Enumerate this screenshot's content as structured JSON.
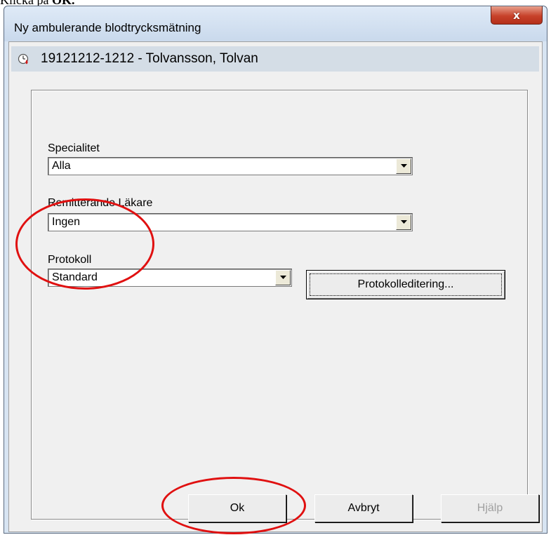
{
  "document": {
    "text_prefix": "Klicka på ",
    "text_bold": "OK."
  },
  "window": {
    "title": "Ny ambulerande blodtrycksmätning",
    "close_label": "x"
  },
  "patient": {
    "icon": "blood-pressure-icon",
    "label": "19121212-1212 - Tolvansson, Tolvan"
  },
  "form": {
    "specialitet": {
      "label": "Specialitet",
      "value": "Alla"
    },
    "remitterande": {
      "label": "Remitterande Läkare",
      "value": "Ingen"
    },
    "protokoll": {
      "label": "Protokoll",
      "value": "Standard"
    },
    "protokolleditering_label": "Protokolleditering..."
  },
  "buttons": {
    "ok": "Ok",
    "avbryt": "Avbryt",
    "hjalp": "Hjälp"
  },
  "colors": {
    "annotation": "#e01010",
    "close_button": "#c7412a"
  }
}
